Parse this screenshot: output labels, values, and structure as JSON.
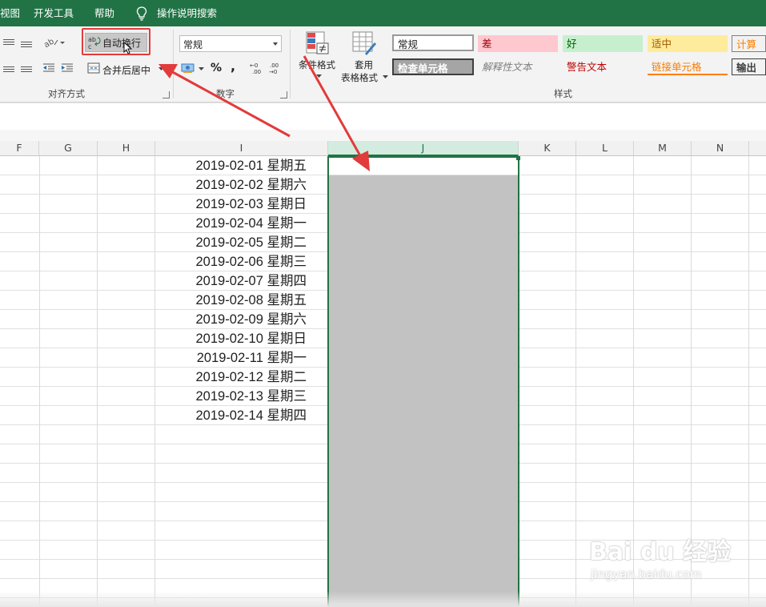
{
  "menu": {
    "view_partial": "视图",
    "developer": "开发工具",
    "help": "帮助",
    "search": "操作说明搜索"
  },
  "alignment": {
    "wrap_text": "自动换行",
    "merge_center": "合并后居中",
    "group_label": "对齐方式"
  },
  "number": {
    "format_value": "常规",
    "percent": "%",
    "comma": ",",
    "group_label": "数字"
  },
  "styles": {
    "conditional_format_line1": "条件格式",
    "table_format_line1": "套用",
    "table_format_line2": "表格格式",
    "group_label": "样式",
    "cells": [
      {
        "label": "常规",
        "bg": "#ffffff",
        "fg": "#222222"
      },
      {
        "label": "差",
        "bg": "#ffc7ce",
        "fg": "#9c0006"
      },
      {
        "label": "好",
        "bg": "#c6efce",
        "fg": "#006100"
      },
      {
        "label": "适中",
        "bg": "#ffeb9c",
        "fg": "#9c5700"
      },
      {
        "label": "计算",
        "bg": "#f2f2f2",
        "fg": "#fa7d00"
      },
      {
        "label": "检查单元格",
        "bg": "#a5a5a5",
        "fg": "#ffffff"
      },
      {
        "label": "解释性文本",
        "bg": "#f3f3f3",
        "fg": "#7f7f7f"
      },
      {
        "label": "警告文本",
        "bg": "#f3f3f3",
        "fg": "#c00000"
      },
      {
        "label": "链接单元格",
        "bg": "#f3f3f3",
        "fg": "#fa7d00"
      },
      {
        "label": "输出",
        "bg": "#f2f2f2",
        "fg": "#3f3f3f"
      }
    ]
  },
  "columns": [
    "F",
    "G",
    "H",
    "I",
    "J",
    "K",
    "L",
    "M",
    "N"
  ],
  "dates": [
    "2019-02-01 星期五",
    "2019-02-02 星期六",
    "2019-02-03 星期日",
    "2019-02-04 星期一",
    "2019-02-05 星期二",
    "2019-02-06 星期三",
    "2019-02-07 星期四",
    "2019-02-08 星期五",
    "2019-02-09 星期六",
    "2019-02-10 星期日",
    "2019-02-11 星期一",
    "2019-02-12 星期二",
    "2019-02-13 星期三",
    "2019-02-14 星期四"
  ],
  "colors": {
    "excel_green": "#217346",
    "annotation_red": "#e23b3b",
    "selection_gray": "#c2c2c2"
  },
  "watermark": {
    "main": "Bai du 经验",
    "sub": "jingyan.baidu.com"
  }
}
